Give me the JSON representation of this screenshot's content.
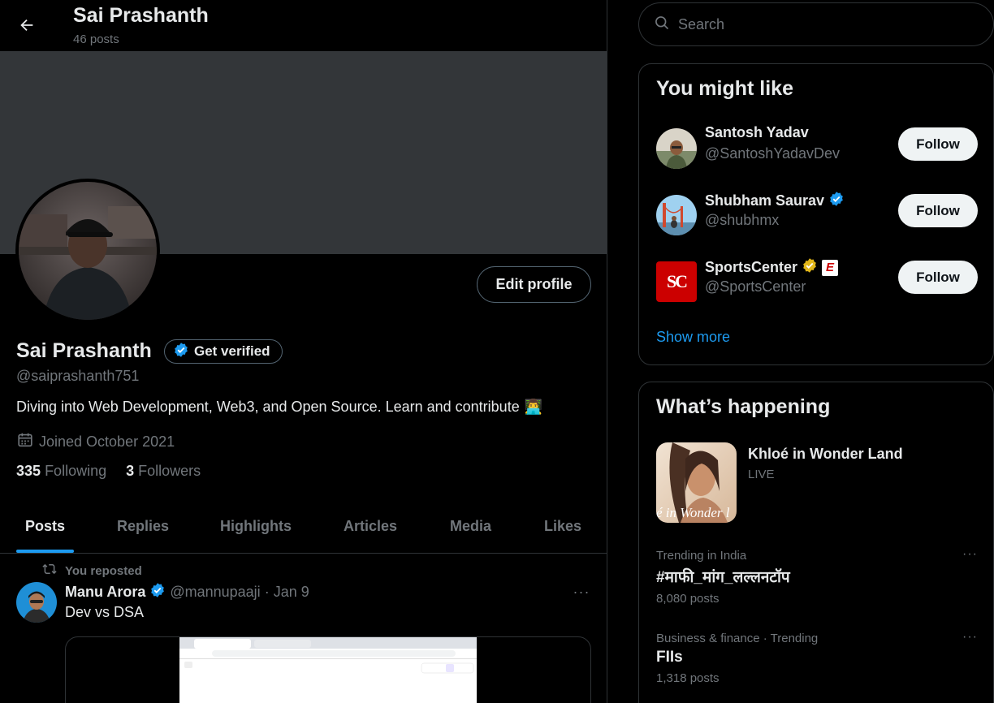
{
  "header": {
    "name": "Sai Prashanth",
    "post_count": "46 posts"
  },
  "profile": {
    "name": "Sai Prashanth",
    "get_verified_label": "Get verified",
    "handle": "@saiprashanth751",
    "bio": "Diving into Web Development, Web3, and Open Source. Learn and contribute",
    "bio_emoji": "👨‍💻",
    "joined": "Joined October 2021",
    "following_count": "335",
    "following_label": "Following",
    "followers_count": "3",
    "followers_label": "Followers",
    "edit_label": "Edit profile"
  },
  "tabs": [
    {
      "label": "Posts",
      "active": true
    },
    {
      "label": "Replies",
      "active": false
    },
    {
      "label": "Highlights",
      "active": false
    },
    {
      "label": "Articles",
      "active": false
    },
    {
      "label": "Media",
      "active": false
    },
    {
      "label": "Likes",
      "active": false
    }
  ],
  "post": {
    "repost_label": "You reposted",
    "author_name": "Manu Arora",
    "author_handle": "@mannupaaji",
    "separator": "·",
    "date": "Jan 9",
    "text": "Dev vs DSA",
    "more": "···"
  },
  "search": {
    "placeholder": "Search"
  },
  "suggestions": {
    "title": "You might like",
    "show_more": "Show more",
    "follow_label": "Follow",
    "items": [
      {
        "name": "Santosh Yadav",
        "handle": "@SantoshYadavDev",
        "verified": "none"
      },
      {
        "name": "Shubham Saurav",
        "handle": "@shubhmx",
        "verified": "blue"
      },
      {
        "name": "SportsCenter",
        "handle": "@SportsCenter",
        "verified": "gold",
        "affiliate": "E",
        "avatar_text": "SC"
      }
    ]
  },
  "happening": {
    "title": "What’s happening",
    "featured": {
      "title": "Khloé in Wonder Land",
      "status": "LIVE",
      "image_text": "é in Wonder l"
    },
    "trends": [
      {
        "context": "Trending in India",
        "name": "#माफी_मांग_लल्लनटॉप",
        "count": "8,080 posts",
        "more": "···"
      },
      {
        "context": "Business & finance · Trending",
        "name": "FIIs",
        "count": "1,318 posts",
        "more": "···"
      }
    ]
  },
  "colors": {
    "accent": "#1d9bf0",
    "background": "#000000",
    "banner": "#333639",
    "border": "#2f3336",
    "muted_text": "#71767b",
    "verified_gold": "#e2b719",
    "espn_red": "#cc0000"
  }
}
